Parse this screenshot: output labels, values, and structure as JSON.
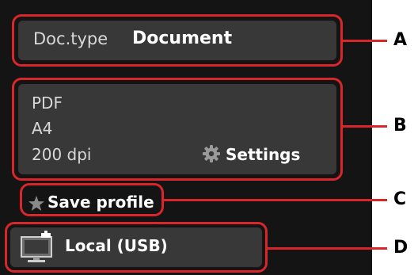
{
  "doc_type": {
    "label": "Doc.type",
    "value": "Document"
  },
  "scan_settings": {
    "format": "PDF",
    "paper_size": "A4",
    "resolution": "200 dpi",
    "settings_label": "Settings",
    "settings_icon": "gear-icon"
  },
  "save_profile": {
    "label": "Save profile",
    "icon": "star-icon"
  },
  "destination": {
    "label": "Local (USB)",
    "icon": "computer-monitor-icon"
  },
  "callouts": [
    "A",
    "B",
    "C",
    "D"
  ],
  "colors": {
    "highlight": "#d9262b",
    "screen_bg": "#141414",
    "panel_bg": "#383838"
  }
}
